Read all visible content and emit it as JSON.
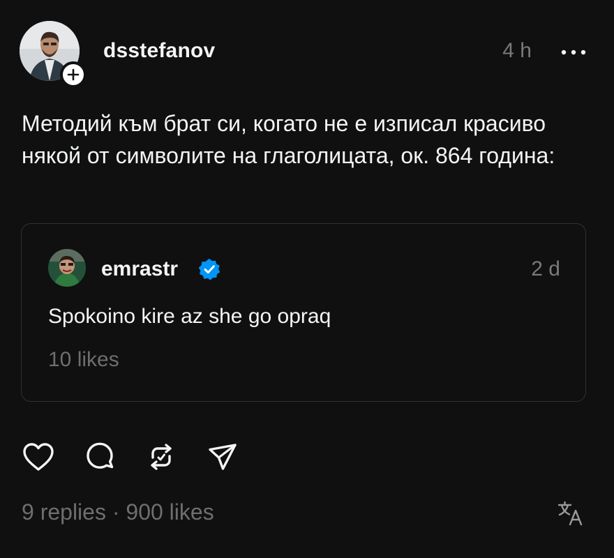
{
  "post": {
    "author": "dsstefanov",
    "time": "4 h",
    "text": "Методий към брат си, когато не е изписал красиво някой от символите на глаголицата, ок. 864 година:",
    "replies": "9 replies",
    "separator": "·",
    "likes": "900 likes"
  },
  "quoted_post": {
    "author": "emrastr",
    "verified": true,
    "time": "2 d",
    "text": "Spokoino kire az she go opraq",
    "likes": "10 likes"
  },
  "icons": {
    "follow": "plus-icon",
    "more": "more-dots-icon",
    "verified": "verified-badge-icon",
    "like": "heart-icon",
    "reply": "comment-bubble-icon",
    "repost": "repost-icon",
    "share": "send-icon",
    "translate": "translate-icon"
  },
  "colors": {
    "background": "#101010",
    "text": "#f3f5f7",
    "muted": "#7a7a7a",
    "border": "#323232",
    "verified": "#0095f6"
  }
}
